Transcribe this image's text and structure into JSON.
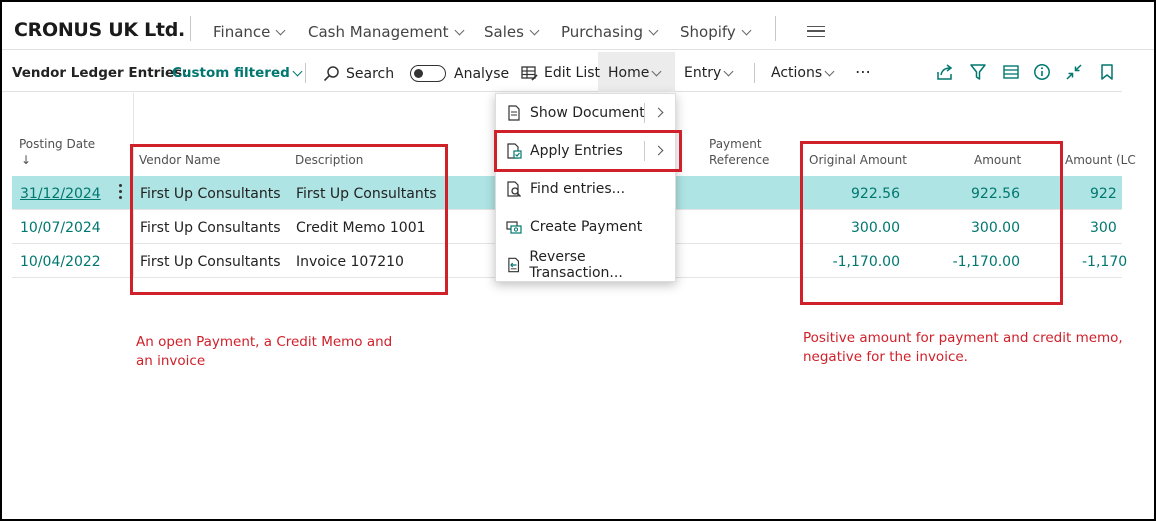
{
  "topnav": {
    "company": "CRONUS UK Ltd.",
    "items": [
      "Finance",
      "Cash Management",
      "Sales",
      "Purchasing",
      "Shopify"
    ]
  },
  "actionbar": {
    "page_title": "Vendor Ledger Entries:",
    "filter": "Custom filtered",
    "search": "Search",
    "analyse": "Analyse",
    "edit_list": "Edit List",
    "home": "Home",
    "entry": "Entry",
    "actions": "Actions",
    "more": "⋯"
  },
  "grid": {
    "headers": {
      "posting_date": "Posting Date",
      "sort_arrow": "↓",
      "vendor_name": "Vendor Name",
      "description": "Description",
      "payment_ref_1": "Payment",
      "payment_ref_2": "Reference",
      "original_amount": "Original Amount",
      "amount": "Amount",
      "amount_lcy": "Amount (LC"
    },
    "rows": [
      {
        "date": "31/12/2024",
        "vendor": "First Up Consultants",
        "desc": "First Up Consultants",
        "orig": "922.56",
        "amount": "922.56",
        "lcy": "922"
      },
      {
        "date": "10/07/2024",
        "vendor": "First Up Consultants",
        "desc": "Credit Memo 1001",
        "orig": "300.00",
        "amount": "300.00",
        "lcy": "300"
      },
      {
        "date": "10/04/2022",
        "vendor": "First Up Consultants",
        "desc": "Invoice 107210",
        "orig": "-1,170.00",
        "amount": "-1,170.00",
        "lcy": "-1,170"
      }
    ]
  },
  "home_menu": {
    "items": [
      "Show Document",
      "Apply Entries",
      "Find entries...",
      "Create Payment",
      "Reverse Transaction..."
    ]
  },
  "notes": {
    "left_1": "An open Payment, a Credit Memo and",
    "left_2": "an invoice",
    "right_1": "Positive amount for payment and credit memo,",
    "right_2": "negative for the invoice."
  },
  "colors": {
    "accent": "#00776f",
    "selected_row": "#aee4e3",
    "annotation": "#d0202a"
  }
}
